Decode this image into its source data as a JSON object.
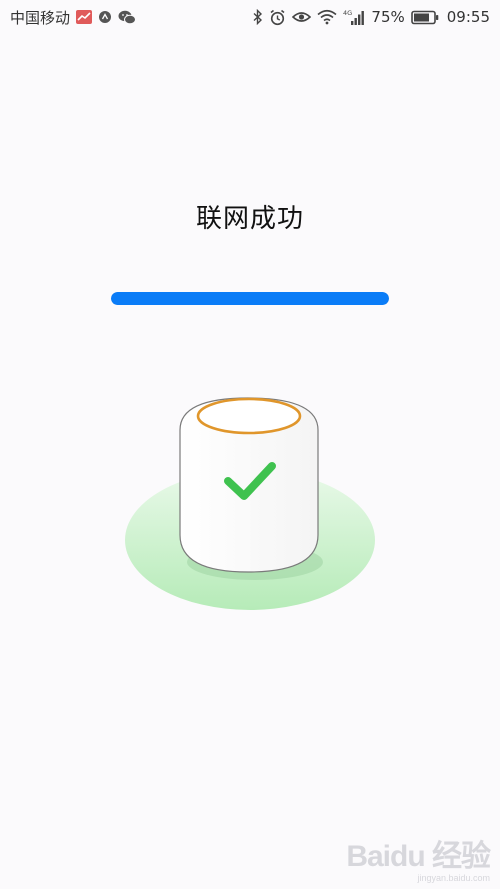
{
  "status_bar": {
    "carrier": "中国移动",
    "network": "4G",
    "battery_percent": "75%",
    "time": "09:55",
    "left_icons": [
      "carrier-badge-icon",
      "notification-icon",
      "wechat-icon"
    ],
    "right_icons": [
      "bluetooth-icon",
      "alarm-icon",
      "eye-icon",
      "wifi-icon",
      "signal-icon",
      "battery-icon"
    ]
  },
  "main": {
    "title": "联网成功",
    "progress": 1.0,
    "progress_color": "#0a7cf7",
    "illustration": "speaker-success-check-icon",
    "check_color": "#3fc24f",
    "ring_color": "#e0962b",
    "ground_color": "#c6f0c6"
  },
  "watermark": {
    "brand": "Baidu 经验",
    "url": "jingyan.baidu.com"
  }
}
